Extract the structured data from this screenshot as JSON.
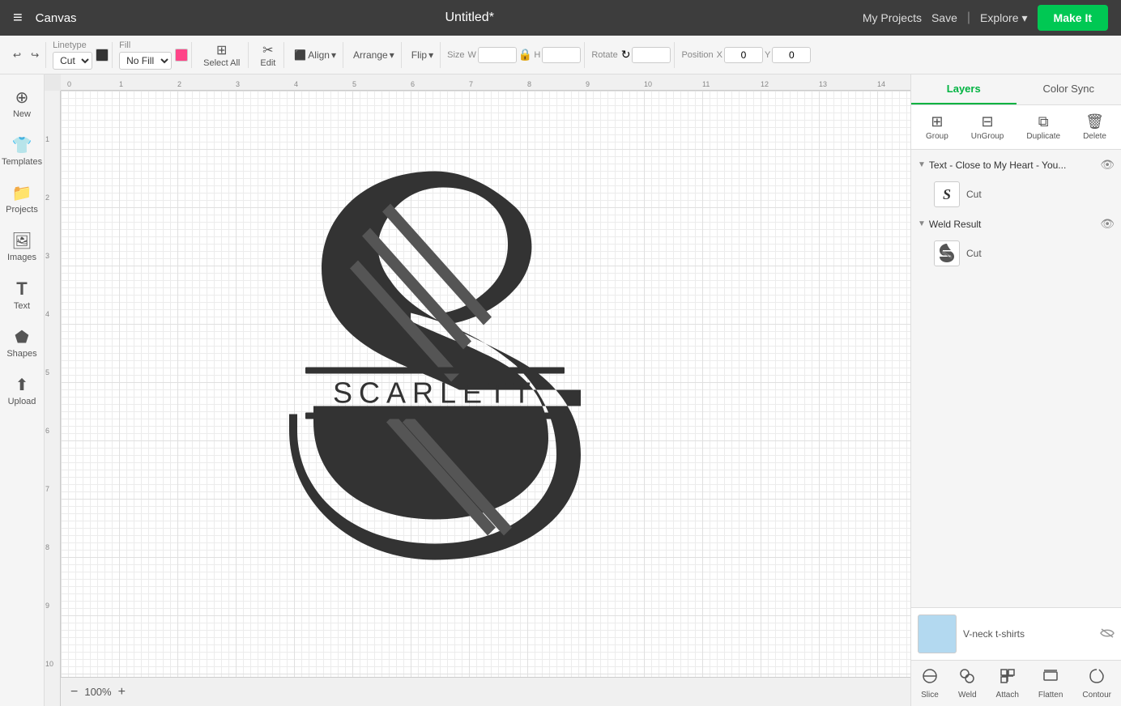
{
  "nav": {
    "hamburger": "≡",
    "canvas_label": "Canvas",
    "title": "Untitled*",
    "my_projects": "My Projects",
    "save": "Save",
    "separator": "|",
    "explore": "Explore",
    "make_it": "Make It"
  },
  "toolbar": {
    "undo_label": "↩",
    "redo_label": "↪",
    "linetype_label": "Linetype",
    "linetype_value": "Cut",
    "fill_label": "Fill",
    "fill_value": "No Fill",
    "select_all_label": "Select All",
    "edit_label": "Edit",
    "align_label": "Align",
    "arrange_label": "Arrange",
    "flip_label": "Flip",
    "size_label": "Size",
    "w_label": "W",
    "h_label": "H",
    "rotate_label": "Rotate",
    "position_label": "Position",
    "x_label": "X",
    "x_value": "0",
    "y_label": "Y",
    "y_value": "0"
  },
  "sidebar": {
    "items": [
      {
        "label": "New",
        "icon": "+"
      },
      {
        "label": "Templates",
        "icon": "👕"
      },
      {
        "label": "Projects",
        "icon": "📁"
      },
      {
        "label": "Images",
        "icon": "🖼"
      },
      {
        "label": "Text",
        "icon": "T"
      },
      {
        "label": "Shapes",
        "icon": "⬟"
      },
      {
        "label": "Upload",
        "icon": "⬆"
      }
    ]
  },
  "layers_panel": {
    "tab_layers": "Layers",
    "tab_color_sync": "Color Sync",
    "group_label": "Group",
    "ungroup_label": "UnGroup",
    "duplicate_label": "Duplicate",
    "delete_label": "Delete",
    "layer_groups": [
      {
        "name": "Text - Close to My Heart - You...",
        "expanded": true,
        "eye_visible": true,
        "items": [
          {
            "thumb_type": "text",
            "thumb_char": "S",
            "label": "Cut"
          }
        ]
      },
      {
        "name": "Weld Result",
        "expanded": true,
        "eye_visible": true,
        "items": [
          {
            "thumb_type": "weld",
            "label": "Cut"
          }
        ]
      }
    ],
    "mat": {
      "label": "V-neck t-shirts",
      "eye_visible": false
    },
    "bottom_tools": [
      {
        "label": "Slice",
        "icon": "⬡"
      },
      {
        "label": "Weld",
        "icon": "⬡"
      },
      {
        "label": "Attach",
        "icon": "📎"
      },
      {
        "label": "Flatten",
        "icon": "⬡"
      },
      {
        "label": "Contour",
        "icon": "⬡"
      }
    ]
  },
  "canvas": {
    "zoom": "100%",
    "ruler_h": [
      "0",
      "1",
      "2",
      "3",
      "4",
      "5",
      "6",
      "7",
      "8",
      "9",
      "10",
      "11",
      "12",
      "13",
      "14"
    ],
    "ruler_v": [
      "1",
      "2",
      "3",
      "4",
      "5",
      "6",
      "7",
      "8",
      "9",
      "10"
    ]
  }
}
